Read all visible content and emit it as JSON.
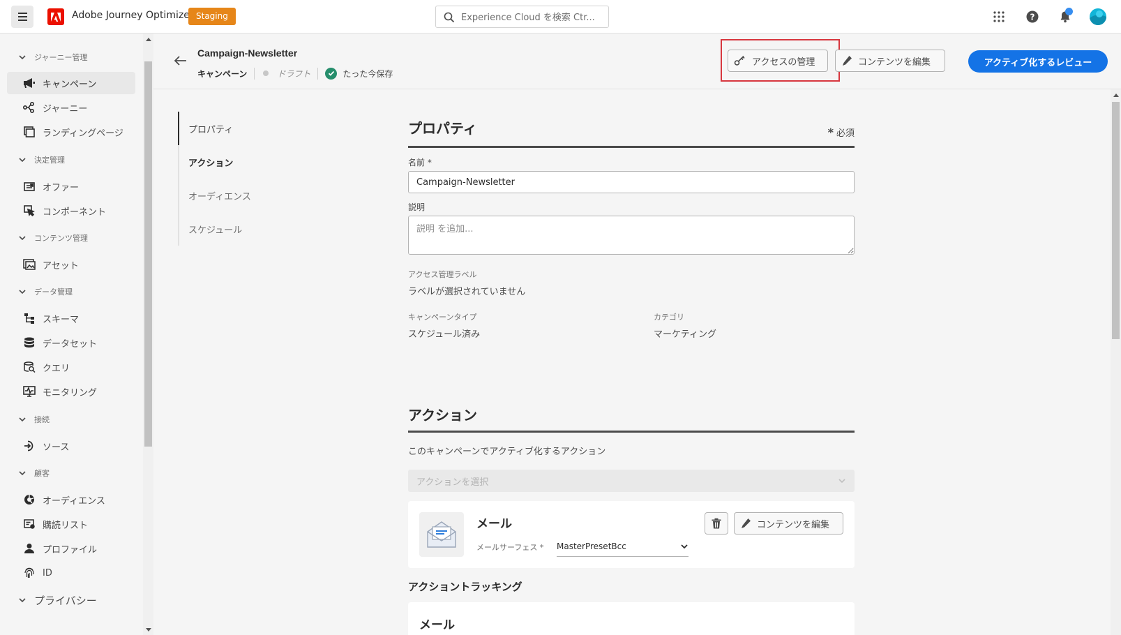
{
  "topbar": {
    "app_title": "Adobe Journey Optimizer",
    "env_badge": "Staging",
    "search_placeholder": "Experience Cloud を検索 Ctr..."
  },
  "sidebar": {
    "groups": [
      {
        "label": "ジャーニー管理",
        "items": [
          {
            "label": "キャンペーン",
            "icon": "megaphone-icon",
            "active": true
          },
          {
            "label": "ジャーニー",
            "icon": "journey-icon"
          },
          {
            "label": "ランディングページ",
            "icon": "landing-page-icon"
          }
        ]
      },
      {
        "label": "決定管理",
        "items": [
          {
            "label": "オファー",
            "icon": "offer-icon"
          },
          {
            "label": "コンポーネント",
            "icon": "components-icon"
          }
        ]
      },
      {
        "label": "コンテンツ管理",
        "items": [
          {
            "label": "アセット",
            "icon": "assets-icon"
          }
        ]
      },
      {
        "label": "データ管理",
        "items": [
          {
            "label": "スキーマ",
            "icon": "schema-icon"
          },
          {
            "label": "データセット",
            "icon": "dataset-icon"
          },
          {
            "label": "クエリ",
            "icon": "query-icon"
          },
          {
            "label": "モニタリング",
            "icon": "monitoring-icon"
          }
        ]
      },
      {
        "label": "接続",
        "items": [
          {
            "label": "ソース",
            "icon": "sources-icon"
          }
        ]
      },
      {
        "label": "顧客",
        "items": [
          {
            "label": "オーディエンス",
            "icon": "audience-icon"
          },
          {
            "label": "購読リスト",
            "icon": "subscription-list-icon"
          },
          {
            "label": "プロファイル",
            "icon": "profile-icon"
          },
          {
            "label": "ID",
            "icon": "fingerprint-icon"
          }
        ]
      },
      {
        "label": "プライバシー",
        "items": []
      }
    ]
  },
  "header": {
    "title": "Campaign-Newsletter",
    "type": "キャンペーン",
    "status": "ドラフト",
    "saved": "たった今保存",
    "manage_access": "アクセスの管理",
    "edit_content": "コンテンツを編集",
    "review_activate": "アクティブ化するレビュー"
  },
  "toc": [
    "プロパティ",
    "アクション",
    "オーディエンス",
    "スケジュール"
  ],
  "properties": {
    "title": "プロパティ",
    "required": "必須",
    "name_label": "名前",
    "name_value": "Campaign-Newsletter",
    "description_label": "説明",
    "description_placeholder": "説明 を追加...",
    "access_label": "アクセス管理ラベル",
    "access_value": "ラベルが選択されていません",
    "campaign_type_label": "キャンペーンタイプ",
    "campaign_type_value": "スケジュール済み",
    "category_label": "カテゴリ",
    "category_value": "マーケティング"
  },
  "actions": {
    "title": "アクション",
    "subtitle": "このキャンペーンでアクティブ化するアクション",
    "select_placeholder": "アクションを選択",
    "card_title": "メール",
    "surface_label": "メールサーフェス",
    "surface_value": "MasterPresetBcc",
    "edit_content": "コンテンツを編集",
    "tracking_title": "アクショントラッキング",
    "tracking_card": "メール"
  }
}
